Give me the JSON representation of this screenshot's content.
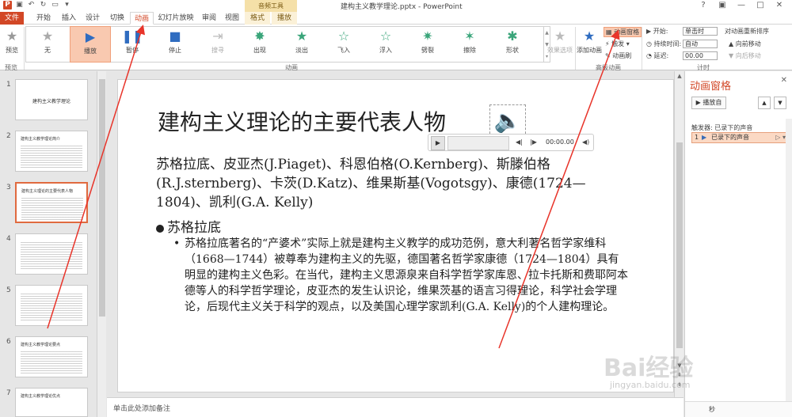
{
  "window": {
    "doc_title": "建构主义教学理论.pptx - PowerPoint",
    "context_tool_group": "音频工具"
  },
  "tabs": {
    "file": "文件",
    "start": "开始",
    "insert": "插入",
    "design": "设计",
    "transitions": "切换",
    "animations": "动画",
    "slideshow": "幻灯片放映",
    "review": "审阅",
    "view": "视图",
    "format": "格式",
    "playback": "播放"
  },
  "ribbon": {
    "preview": "预览",
    "preview_group": "预览",
    "animation_group": "动画",
    "advanced_group": "高级动画",
    "timing_group": "计时",
    "gallery": [
      "无",
      "播放",
      "暂停",
      "停止",
      "搜寻",
      "出现",
      "淡出",
      "飞入",
      "浮入",
      "劈裂",
      "擦除",
      "形状"
    ],
    "effect_options": "效果选项",
    "add_animation": "添加动画",
    "animation_pane_btn": "动画窗格",
    "trigger": "触发",
    "animation_painter": "动画刷",
    "start_label": "开始:",
    "start_value": "单击时",
    "duration_label": "持续时间:",
    "duration_value": "自动",
    "delay_label": "延迟:",
    "delay_value": "00.00",
    "reorder": "对动画重新排序",
    "move_earlier": "向前移动",
    "move_later": "向后移动"
  },
  "thumbnails": [
    {
      "num": "1",
      "title": "建构主义教学理论",
      "center": true
    },
    {
      "num": "2",
      "title": "建构主义教学理论简介"
    },
    {
      "num": "3",
      "title": "建构主义理论的主要代表人物"
    },
    {
      "num": "4",
      "title": ""
    },
    {
      "num": "5",
      "title": ""
    },
    {
      "num": "6",
      "title": "建构主义教学理论要点"
    },
    {
      "num": "7",
      "title": "建构主义教学理论优点"
    }
  ],
  "slide": {
    "title": "建构主义理论的主要代表人物",
    "paragraph": "苏格拉底、皮亚杰(J.Piaget)、科恩伯格(O.Kernberg)、斯滕伯格(R.J.sternberg)、卡茨(D.Katz)、维果斯基(Vogotsgy)、康德(1724—1804)、凯利(G.A. Kelly)",
    "bullet_heading": "苏格拉底",
    "sub_paragraph": "苏格拉底著名的“产婆术”实际上就是建构主义教学的成功范例，意大利著名哲学家维科（1668—1744）被尊奉为建构主义的先驱，德国著名哲学家康德（1724—1804）具有明显的建构主义色彩。在当代，建构主义思源泉来自科学哲学家库恩、拉卡托斯和费耶阿本德等人的科学哲学理论，皮亚杰的发生认识论，维果茨基的语言习得理论，科学社会学理论，后现代主义关于科学的观点，以及美国心理学家凯利(G.A. Kelly)的个人建构理论。",
    "audio_time": "00:00.00"
  },
  "notes": {
    "placeholder": "单击此处添加备注"
  },
  "pane": {
    "title": "动画窗格",
    "play_from": "播放自",
    "trigger_label": "触发器: 已录下的声音",
    "item_num": "1",
    "item_label": "已录下的声音",
    "footer": "秒"
  },
  "watermark": {
    "brand": "Bai经验",
    "url": "jingyan.baidu.com"
  },
  "colors": {
    "accent": "#d24726",
    "arrow": "#e8342a",
    "selection": "#f9c9b0"
  }
}
